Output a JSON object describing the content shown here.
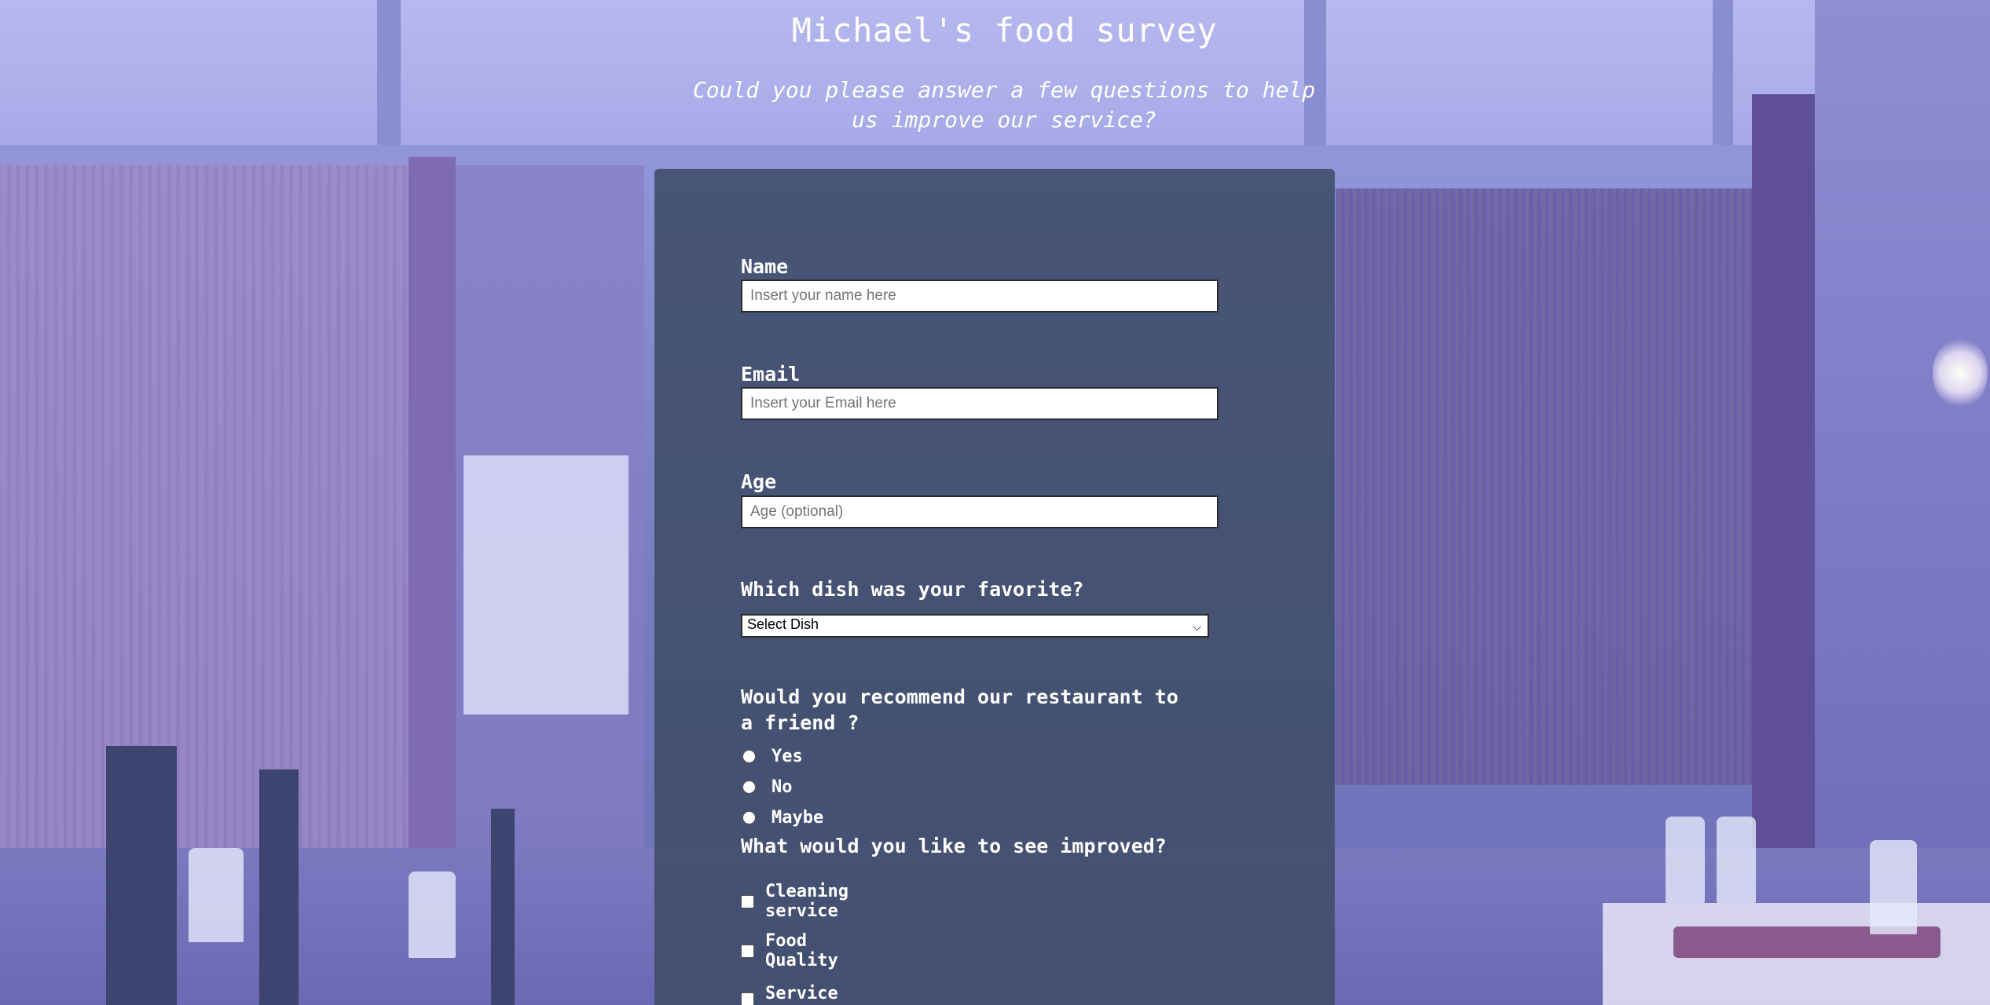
{
  "page": {
    "title": "Michael's food survey",
    "subtitle": "Could you please answer a few questions to help us improve our service?"
  },
  "form": {
    "name": {
      "label": "Name",
      "placeholder": "Insert your name here",
      "value": ""
    },
    "email": {
      "label": "Email",
      "placeholder": "Insert your Email here",
      "value": ""
    },
    "age": {
      "label": "Age",
      "placeholder": "Age (optional)",
      "value": ""
    },
    "dish": {
      "label": "Which dish was your favorite?",
      "selected": "Select Dish",
      "icon": "chevron-down-icon"
    },
    "recommend": {
      "label": "Would you recommend our restaurant to a friend ?",
      "options": [
        "Yes",
        "No",
        "Maybe"
      ],
      "selected": null
    },
    "improve": {
      "label": "What would you like to see improved?",
      "options": [
        "Cleaning service",
        "Food Quality",
        "Service"
      ],
      "checked": []
    }
  },
  "colors": {
    "panel": "#3e4c68",
    "background_tint": "#7d7fc9",
    "text": "#ffffff"
  }
}
